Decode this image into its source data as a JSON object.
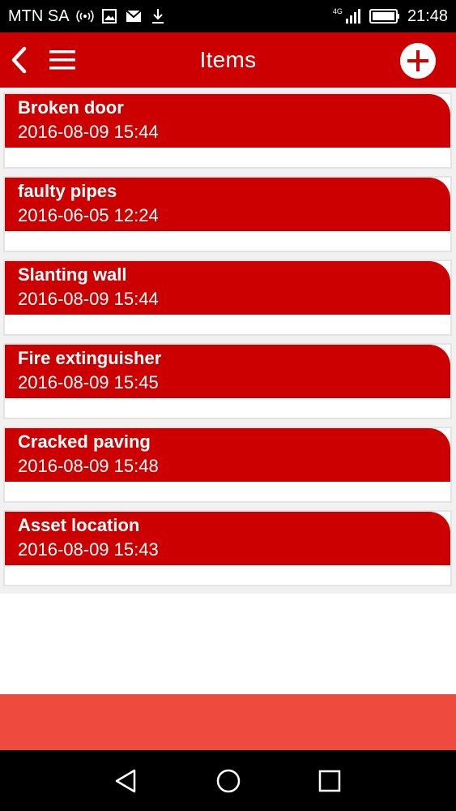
{
  "status_bar": {
    "carrier": "MTN SA",
    "network_badge": "4G",
    "time": "21:48",
    "icons": [
      "hotspot-icon",
      "image-icon",
      "mail-icon",
      "download-icon",
      "signal-icon",
      "battery-icon"
    ]
  },
  "app_bar": {
    "title": "Items",
    "back_icon": "chevron-left-icon",
    "menu_icon": "hamburger-icon",
    "add_icon": "plus-circle-icon"
  },
  "items": [
    {
      "name": "Broken door",
      "date": "2016-08-09 15:44"
    },
    {
      "name": "faulty pipes",
      "date": "2016-06-05 12:24"
    },
    {
      "name": "Slanting wall",
      "date": "2016-08-09 15:44"
    },
    {
      "name": "Fire extinguisher",
      "date": "2016-08-09 15:45"
    },
    {
      "name": "Cracked paving",
      "date": "2016-08-09 15:48"
    },
    {
      "name": "Asset location",
      "date": "2016-08-09 15:43"
    }
  ],
  "colors": {
    "brand_red": "#cc0000",
    "footer_red": "#ee4a3e"
  }
}
